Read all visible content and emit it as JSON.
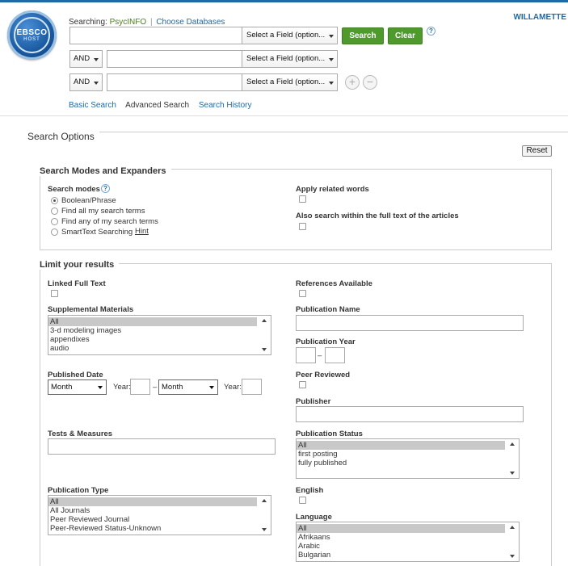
{
  "header": {
    "logo_text": "EBSCO",
    "logo_subtext": "HOST",
    "searching_label": "Searching:",
    "database": "PsycINFO",
    "choose_databases": "Choose Databases",
    "institution": "WILLAMETTE",
    "search_rows": [
      {
        "bool": "",
        "value": "",
        "field": "Select a Field (option..."
      },
      {
        "bool": "AND",
        "value": "",
        "field": "Select a Field (option..."
      },
      {
        "bool": "AND",
        "value": "",
        "field": "Select a Field (option..."
      }
    ],
    "search_button": "Search",
    "clear_button": "Clear",
    "help": "?",
    "add_row": "+",
    "remove_row": "−",
    "links": {
      "basic": "Basic Search",
      "advanced": "Advanced Search",
      "history": "Search History"
    }
  },
  "options": {
    "title": "Search Options",
    "reset": "Reset",
    "modes": {
      "title": "Search Modes and Expanders",
      "search_modes_label": "Search modes",
      "help": "?",
      "radios": [
        {
          "label": "Boolean/Phrase",
          "checked": true
        },
        {
          "label": "Find all my search terms",
          "checked": false
        },
        {
          "label": "Find any of my search terms",
          "checked": false
        },
        {
          "label": "SmartText Searching",
          "checked": false
        }
      ],
      "hint": "Hint",
      "apply_related": "Apply related words",
      "full_text": "Also search within the full text of the articles"
    },
    "limits": {
      "title": "Limit your results",
      "linked_full_text": "Linked Full Text",
      "references_available": "References Available",
      "supplemental_label": "Supplemental Materials",
      "supplemental_options": [
        "All",
        "3-d modeling images",
        "appendixes",
        "audio"
      ],
      "publication_name": "Publication Name",
      "publication_year": "Publication Year",
      "year_dash": "–",
      "published_date": "Published Date",
      "month": "Month",
      "year_label": "Year:",
      "peer_reviewed": "Peer Reviewed",
      "publisher": "Publisher",
      "tests_measures": "Tests & Measures",
      "publication_status": "Publication Status",
      "status_options": [
        "All",
        "first posting",
        "fully published"
      ],
      "publication_type": "Publication Type",
      "type_options": [
        "All",
        "All Journals",
        "Peer Reviewed Journal",
        "Peer-Reviewed Status-Unknown"
      ],
      "english": "English",
      "language": "Language",
      "language_options": [
        "All",
        "Afrikaans",
        "Arabic",
        "Bulgarian"
      ]
    }
  }
}
